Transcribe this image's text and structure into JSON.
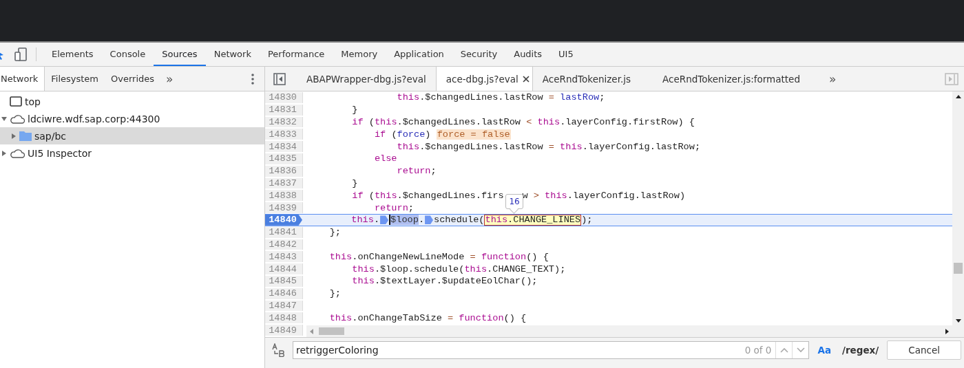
{
  "main_tabs": [
    {
      "label": "Elements",
      "selected": false
    },
    {
      "label": "Console",
      "selected": false
    },
    {
      "label": "Sources",
      "selected": true
    },
    {
      "label": "Network",
      "selected": false
    },
    {
      "label": "Performance",
      "selected": false
    },
    {
      "label": "Memory",
      "selected": false
    },
    {
      "label": "Application",
      "selected": false
    },
    {
      "label": "Security",
      "selected": false
    },
    {
      "label": "Audits",
      "selected": false
    },
    {
      "label": "UI5",
      "selected": false
    }
  ],
  "navigator": {
    "tabs": [
      {
        "label": "Network",
        "selected": true
      },
      {
        "label": "Filesystem",
        "selected": false
      },
      {
        "label": "Overrides",
        "selected": false
      }
    ],
    "more": "»",
    "tree": [
      {
        "label": "top",
        "kind": "frame",
        "selected": false
      },
      {
        "label": "ldciwre.wdf.sap.corp:44300",
        "kind": "domain",
        "expanded": true,
        "selected": false,
        "children": [
          {
            "label": "sap/bc",
            "kind": "folder",
            "expanded": false,
            "selected": true
          }
        ]
      },
      {
        "label": "UI5 Inspector",
        "kind": "domain",
        "expanded": false,
        "selected": false
      }
    ]
  },
  "editor": {
    "tabs": [
      {
        "label": "ABAPWrapper-dbg.js?eval",
        "selected": false
      },
      {
        "label": "ace-dbg.js?eval",
        "selected": true
      },
      {
        "label": "AceRndTokenizer.js",
        "selected": false
      },
      {
        "label": "AceRndTokenizer.js:formatted",
        "selected": false
      }
    ],
    "more": "»",
    "lines": [
      {
        "number": "14830",
        "current": false,
        "tokens": [
          {
            "kind": "keyword",
            "text": "                this"
          },
          {
            "kind": "plain",
            "text": ".$changedLines.lastRow "
          },
          {
            "kind": "operator",
            "text": "="
          },
          {
            "kind": "variable",
            "text": " lastRow"
          },
          {
            "kind": "plain",
            "text": ";"
          }
        ]
      },
      {
        "number": "14831",
        "current": false,
        "tokens": [
          {
            "kind": "plain",
            "text": "        }"
          }
        ]
      },
      {
        "number": "14832",
        "current": false,
        "tokens": [
          {
            "kind": "keyword",
            "text": "        if"
          },
          {
            "kind": "plain",
            "text": " ("
          },
          {
            "kind": "keyword",
            "text": "this"
          },
          {
            "kind": "plain",
            "text": ".$changedLines.lastRow "
          },
          {
            "kind": "operator",
            "text": "<"
          },
          {
            "kind": "keyword",
            "text": " this"
          },
          {
            "kind": "plain",
            "text": ".layerConfig.firstRow) {"
          }
        ]
      },
      {
        "number": "14833",
        "current": false,
        "tokens": [
          {
            "kind": "keyword",
            "text": "            if"
          },
          {
            "kind": "plain",
            "text": " ("
          },
          {
            "kind": "variable",
            "text": "force"
          },
          {
            "kind": "plain",
            "text": ")"
          },
          {
            "kind": "inline-value",
            "text": "force = false"
          }
        ]
      },
      {
        "number": "14834",
        "current": false,
        "tokens": [
          {
            "kind": "keyword",
            "text": "                this"
          },
          {
            "kind": "plain",
            "text": ".$changedLines.lastRow "
          },
          {
            "kind": "operator",
            "text": "="
          },
          {
            "kind": "keyword",
            "text": " this"
          },
          {
            "kind": "plain",
            "text": ".layerConfig.lastRow;"
          }
        ]
      },
      {
        "number": "14835",
        "current": false,
        "tokens": [
          {
            "kind": "keyword",
            "text": "            else"
          }
        ]
      },
      {
        "number": "14836",
        "current": false,
        "tokens": [
          {
            "kind": "keyword",
            "text": "                return"
          },
          {
            "kind": "plain",
            "text": ";"
          }
        ]
      },
      {
        "number": "14837",
        "current": false,
        "tokens": [
          {
            "kind": "plain",
            "text": "        }"
          }
        ]
      },
      {
        "number": "14838",
        "current": false,
        "tokens": [
          {
            "kind": "keyword",
            "text": "        if"
          },
          {
            "kind": "plain",
            "text": " ("
          },
          {
            "kind": "keyword",
            "text": "this"
          },
          {
            "kind": "plain",
            "text": ".$changedLines.firs"
          },
          {
            "kind": "gap"
          },
          {
            "kind": "plain",
            "text": "w "
          },
          {
            "kind": "operator",
            "text": ">"
          },
          {
            "kind": "keyword",
            "text": " this"
          },
          {
            "kind": "plain",
            "text": ".layerConfig.lastRow)"
          }
        ]
      },
      {
        "number": "14839",
        "current": false,
        "tokens": [
          {
            "kind": "keyword",
            "text": "            return"
          },
          {
            "kind": "plain",
            "text": ";"
          }
        ]
      },
      {
        "number": "14840",
        "current": true,
        "tokens": [
          {
            "kind": "keyword",
            "text": "        this"
          },
          {
            "kind": "plain",
            "text": "."
          },
          {
            "kind": "step-marker"
          },
          {
            "kind": "selection",
            "text": "$loop"
          },
          {
            "kind": "plain",
            "text": "."
          },
          {
            "kind": "step-marker"
          },
          {
            "kind": "plain",
            "text": "schedule("
          },
          {
            "kind": "evaluated",
            "tooltip": "16",
            "tokens": [
              {
                "kind": "keyword",
                "text": "this"
              },
              {
                "kind": "plain",
                "text": ".CHANGE_LINES"
              }
            ]
          },
          {
            "kind": "plain",
            "text": ");"
          }
        ]
      },
      {
        "number": "14841",
        "current": false,
        "tokens": [
          {
            "kind": "plain",
            "text": "    };"
          }
        ]
      },
      {
        "number": "14842",
        "current": false
      },
      {
        "number": "14843",
        "current": false,
        "tokens": [
          {
            "kind": "keyword",
            "text": "    this"
          },
          {
            "kind": "plain",
            "text": ".onChangeNewLineMode "
          },
          {
            "kind": "operator",
            "text": "="
          },
          {
            "kind": "keyword",
            "text": " function"
          },
          {
            "kind": "plain",
            "text": "() {"
          }
        ]
      },
      {
        "number": "14844",
        "current": false,
        "tokens": [
          {
            "kind": "keyword",
            "text": "        this"
          },
          {
            "kind": "plain",
            "text": ".$loop.schedule("
          },
          {
            "kind": "keyword",
            "text": "this"
          },
          {
            "kind": "plain",
            "text": ".CHANGE_TEXT);"
          }
        ]
      },
      {
        "number": "14845",
        "current": false,
        "tokens": [
          {
            "kind": "keyword",
            "text": "        this"
          },
          {
            "kind": "plain",
            "text": ".$textLayer.$updateEolChar();"
          }
        ]
      },
      {
        "number": "14846",
        "current": false,
        "tokens": [
          {
            "kind": "plain",
            "text": "    };"
          }
        ]
      },
      {
        "number": "14847",
        "current": false
      },
      {
        "number": "14848",
        "current": false,
        "tokens": [
          {
            "kind": "keyword",
            "text": "    this"
          },
          {
            "kind": "plain",
            "text": ".onChangeTabSize "
          },
          {
            "kind": "operator",
            "text": "="
          },
          {
            "kind": "keyword",
            "text": " function"
          },
          {
            "kind": "plain",
            "text": "() {"
          }
        ]
      },
      {
        "number": "14849",
        "current": false
      }
    ]
  },
  "search": {
    "value": "retriggerColoring",
    "count": "0 of 0",
    "match_case": {
      "label": "Aa",
      "on": true
    },
    "regex": {
      "label": "/regex/",
      "on": false
    },
    "cancel": "Cancel"
  }
}
